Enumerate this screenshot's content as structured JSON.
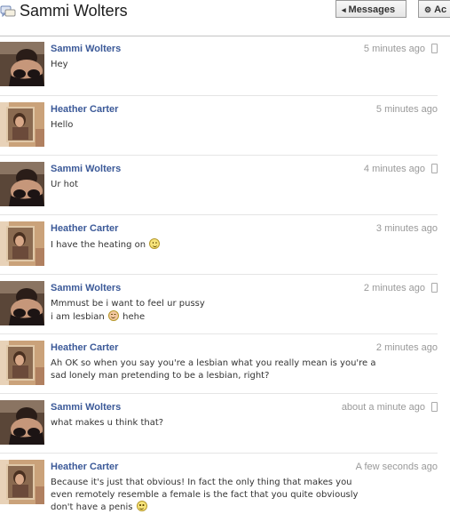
{
  "header": {
    "title": "Sammi Wolters",
    "messages_button": "Messages",
    "actions_button": "Ac"
  },
  "messages": [
    {
      "sender": "Sammi Wolters",
      "time": "5 minutes ago",
      "lines": [
        "Hey"
      ],
      "mobile": true
    },
    {
      "sender": "Heather Carter",
      "time": "5 minutes ago",
      "lines": [
        "Hello"
      ],
      "mobile": false
    },
    {
      "sender": "Sammi Wolters",
      "time": "4 minutes ago",
      "lines": [
        "Ur hot"
      ],
      "mobile": true
    },
    {
      "sender": "Heather Carter",
      "time": "3 minutes ago",
      "lines": [
        "I have the heating on"
      ],
      "mobile": false
    },
    {
      "sender": "Sammi Wolters",
      "time": "2 minutes ago",
      "lines": [
        "Mmmust be i want to feel ur pussy",
        "i am lesbian",
        "hehe"
      ],
      "mobile": true
    },
    {
      "sender": "Heather Carter",
      "time": "2 minutes ago",
      "lines": [
        "Ah OK so when you say you're a lesbian what you really mean is you're a",
        "sad lonely man pretending to be a lesbian, right?"
      ],
      "mobile": false
    },
    {
      "sender": "Sammi Wolters",
      "time": "about a minute ago",
      "lines": [
        "what makes u think that?"
      ],
      "mobile": true
    },
    {
      "sender": "Heather Carter",
      "time": "A few seconds ago",
      "lines": [
        "Because it's just that obvious! In fact the only thing that makes you",
        "even remotely resemble a female is the fact that you quite obviously",
        "don't have a penis"
      ],
      "mobile": false
    }
  ],
  "icons": {
    "header": "chat-bubbles-icon",
    "messages_button": "back-arrow-icon",
    "actions_button": "gear-icon",
    "mobile": "mobile-phone-icon",
    "emoticon": "smiley-icon"
  },
  "colors": {
    "sender_link": "#3b5998",
    "timestamp": "#999999",
    "divider": "#e5e5e5"
  }
}
